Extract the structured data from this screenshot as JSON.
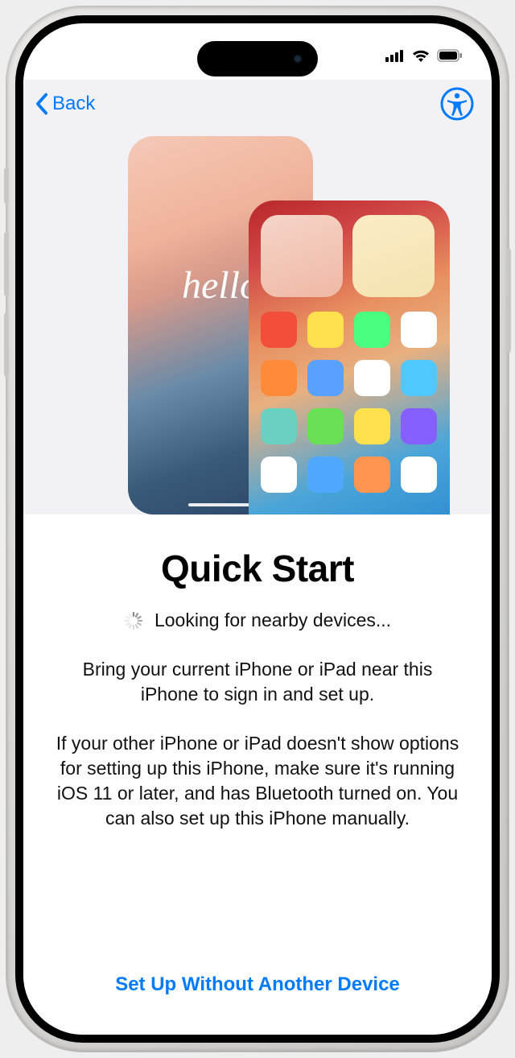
{
  "nav": {
    "back_label": "Back"
  },
  "hero": {
    "hello_text": "hello"
  },
  "content": {
    "title": "Quick Start",
    "status_text": "Looking for nearby devices...",
    "body1": "Bring your current iPhone or iPad near this iPhone to sign in and set up.",
    "body2": "If your other iPhone or iPad doesn't show options for setting up this iPhone, make sure it's running iOS 11 or later, and has Bluetooth turned on. You can also set up this iPhone manually."
  },
  "footer": {
    "link_label": "Set Up Without Another Device"
  },
  "app_icon_colors": [
    "#f24e3a",
    "#ffe14d",
    "#4aff80",
    "#ffffff",
    "#ff8a3a",
    "#5aa0ff",
    "#ffffff",
    "#50c8ff",
    "#6ad0c0",
    "#6ae055",
    "#ffe14d",
    "#8560ff",
    "#ffffff",
    "#50a8ff",
    "#ff9550",
    "#ffffff"
  ]
}
